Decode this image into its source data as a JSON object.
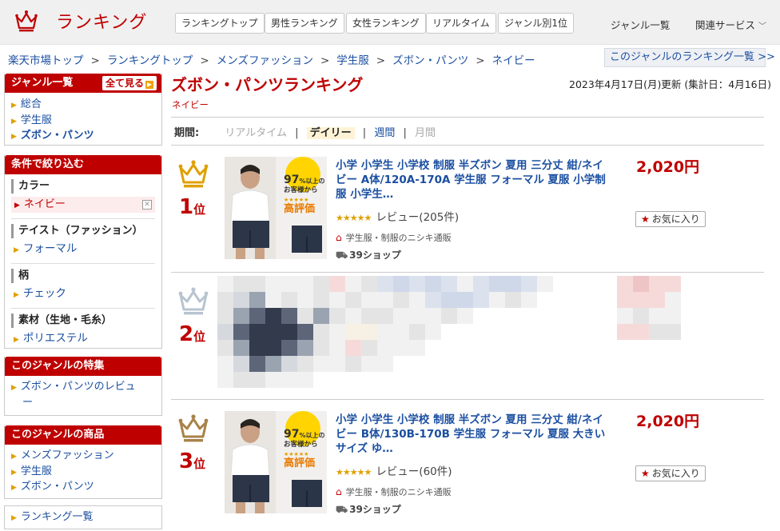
{
  "header": {
    "logo_text": "ランキング",
    "tabs": [
      "ランキングトップ",
      "男性ランキング",
      "女性ランキング",
      "リアルタイム",
      "ジャンル別1位"
    ],
    "link_genre_list": "ジャンル一覧",
    "link_related": "関連サービス"
  },
  "breadcrumb": [
    "楽天市場トップ",
    "ランキングトップ",
    "メンズファッション",
    "学生服",
    "ズボン・パンツ",
    "ネイビー"
  ],
  "genre_ranking_list_button": "このジャンルのランキング一覧 >>",
  "sidebar": {
    "genre_box": {
      "title": "ジャンル一覧",
      "see_all": "全て見る",
      "items": [
        "総合",
        "学生服",
        "ズボン・パンツ"
      ]
    },
    "filter_box": {
      "title": "条件で絞り込む",
      "groups": [
        {
          "label": "カラー",
          "selected": "ネイビー"
        },
        {
          "label": "テイスト（ファッション）",
          "item": "フォーマル"
        },
        {
          "label": "柄",
          "item": "チェック"
        },
        {
          "label": "素材（生地・毛糸）",
          "item": "ポリエステル"
        }
      ]
    },
    "feature_box": {
      "title": "このジャンルの特集",
      "items": [
        "ズボン・パンツのレビュ",
        "ー"
      ]
    },
    "products_box": {
      "title": "このジャンルの商品",
      "items": [
        "メンズファッション",
        "学生服",
        "ズボン・パンツ"
      ]
    },
    "ranking_list_box": {
      "items": [
        "ランキング一覧"
      ]
    }
  },
  "main": {
    "title": "ズボン・パンツランキング",
    "subtitle": "ネイビー",
    "updated": "2023年4月17日(月)更新 (集計日：4月16日)",
    "period": {
      "label": "期間:",
      "realtime": "リアルタイム",
      "daily": "デイリー",
      "weekly": "週間",
      "monthly": "月間",
      "sep": "|"
    },
    "items": [
      {
        "rank": "1",
        "rank_suffix": "位",
        "title": "小学 小学生 小学校 制服 半ズボン 夏用 三分丈 紺/ネイビー A体/120A-170A 学生服 フォーマル 夏服 小学制服 小学生…",
        "stars": "★★★★★",
        "reviews": "レビュー(205件)",
        "shop": "学生服・制服のニシキ通販",
        "shipping": "39ショップ",
        "price": "2,020円",
        "favorite": "お気に入り",
        "thumb_text": [
          "97",
          "%以上の",
          "お客様から",
          "高評価"
        ]
      },
      {
        "rank": "2",
        "rank_suffix": "位"
      },
      {
        "rank": "3",
        "rank_suffix": "位",
        "title": "小学 小学生 小学校 制服 半ズボン 夏用 三分丈 紺/ネイビー B体/130B-170B 学生服 フォーマル 夏服 大きいサイズ ゆ…",
        "stars": "★★★★★",
        "reviews": "レビュー(60件)",
        "shop": "学生服・制服のニシキ通販",
        "shipping": "39ショップ",
        "price": "2,020円",
        "favorite": "お気に入り",
        "thumb_text": [
          "97",
          "%以上の",
          "お客様から",
          "高評価"
        ]
      }
    ]
  },
  "colors": {
    "brand_red": "#bf0000",
    "link_blue": "#1b4fa1",
    "gold": "#e0a000",
    "silver": "#b8c4d0",
    "bronze": "#a8824a"
  }
}
